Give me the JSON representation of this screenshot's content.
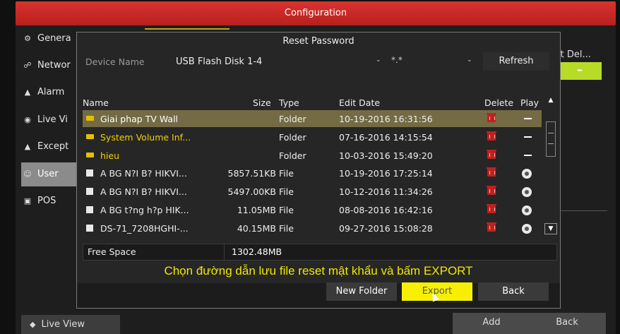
{
  "window": {
    "title": "Configuration"
  },
  "sidebar": {
    "items": [
      {
        "label": "Genera",
        "icon": "gear-icon",
        "glyph": "⚙"
      },
      {
        "label": "Networ",
        "icon": "network-icon",
        "glyph": "☍"
      },
      {
        "label": "Alarm",
        "icon": "alarm-icon",
        "glyph": "▲"
      },
      {
        "label": "Live Vi",
        "icon": "eye-icon",
        "glyph": "◉"
      },
      {
        "label": "Except",
        "icon": "warning-icon",
        "glyph": "▲"
      },
      {
        "label": "User",
        "icon": "user-icon",
        "glyph": "☺"
      },
      {
        "label": "POS",
        "icon": "pos-icon",
        "glyph": "▣"
      }
    ]
  },
  "background": {
    "header_right": "it  Del...",
    "green_cell": "–",
    "liveview_label": "Live View",
    "add_label": "Add",
    "back_label": "Back"
  },
  "dialog": {
    "title": "Reset Password",
    "device_label": "Device Name",
    "device_value": "USB Flash Disk 1-4",
    "filter_value": "*.*",
    "refresh_label": "Refresh",
    "columns": {
      "name": "Name",
      "size": "Size",
      "type": "Type",
      "date": "Edit Date",
      "delete": "Delete",
      "play": "Play"
    },
    "rows": [
      {
        "name": "Giai phap TV Wall",
        "size": "",
        "type": "Folder",
        "date": "10-19-2016 16:31:56",
        "kind": "folder",
        "action": "dash"
      },
      {
        "name": "System Volume Inf...",
        "size": "",
        "type": "Folder",
        "date": "07-16-2016 14:15:54",
        "kind": "folder",
        "action": "dash"
      },
      {
        "name": "hieu",
        "size": "",
        "type": "Folder",
        "date": "10-03-2016 15:49:20",
        "kind": "folder",
        "action": "dash"
      },
      {
        "name": "A BG N?I B? HIKVI...",
        "size": "5857.51KB",
        "type": "File",
        "date": "10-19-2016 17:25:14",
        "kind": "file",
        "action": "play"
      },
      {
        "name": "A BG N?I B? HIKVI...",
        "size": "5497.00KB",
        "type": "File",
        "date": "10-12-2016 11:34:26",
        "kind": "file",
        "action": "play"
      },
      {
        "name": "A BG t?ng h?p HIK...",
        "size": "11.05MB",
        "type": "File",
        "date": "08-08-2016 16:42:16",
        "kind": "file",
        "action": "play"
      },
      {
        "name": "DS-71_7208HGHI-...",
        "size": "40.15MB",
        "type": "File",
        "date": "09-27-2016 15:08:28",
        "kind": "file",
        "action": "play"
      }
    ],
    "selected_row": 0,
    "free_space_label": "Free Space",
    "free_space_value": "1302.48MB",
    "caption": "Chọn đường dẫn lưu file reset mật khẩu và bấm EXPORT",
    "buttons": {
      "new_folder": "New Folder",
      "export": "Export",
      "back": "Back"
    }
  },
  "colors": {
    "title_bar": "#c8281f",
    "selected_row": "#746b45",
    "folder_text": "#f3d000",
    "export_button": "#f6f000",
    "caption": "#f0e800"
  }
}
